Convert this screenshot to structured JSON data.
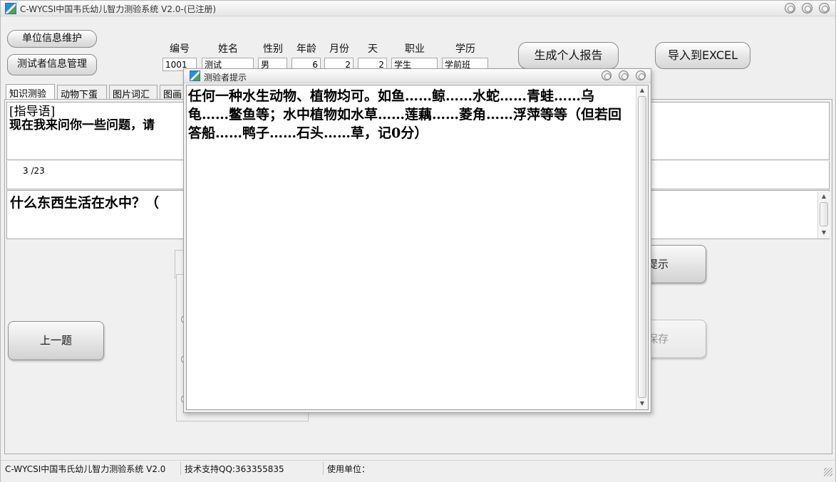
{
  "window": {
    "title": "C-WYCSI中国韦氏幼儿智力测验系统 V2.0-(已注册)"
  },
  "buttons": {
    "unit_info": "单位信息维护",
    "tester_info": "测试者信息管理",
    "generate_report": "生成个人报告",
    "export_excel": "导入到EXCEL",
    "prev_question": "上一题",
    "hint_partial": "提示",
    "save_partial": "保存"
  },
  "subject": {
    "labels": {
      "id": "编号",
      "name": "姓名",
      "gender": "性别",
      "age": "年龄",
      "month": "月份",
      "day": "天",
      "job": "职业",
      "education": "学历"
    },
    "values": {
      "id": "1001",
      "name": "测试",
      "gender": "男",
      "age": "6",
      "month": "2",
      "day": "2",
      "job": "学生",
      "education": "学前班"
    }
  },
  "tabs": [
    "知识测验",
    "动物下蛋",
    "图片词汇",
    "图画"
  ],
  "instruction": {
    "heading": "[指导语]",
    "text_visible": "现在我来问你一些问题，请"
  },
  "progress": "3 /23",
  "question": {
    "text_visible": "什么东西生活在水中？（"
  },
  "dialog": {
    "title": "测验者提示",
    "body": "任何一种水生动物、植物均可。如鱼……鲸……水蛇……青蛙……乌龟……鳖鱼等；水中植物如水草……莲藕……菱角……浮萍等等（但若回答船……鸭子……石头……草，记0分）"
  },
  "statusbar": {
    "app": "C-WYCSI中国韦氏幼儿智力测验系统 V2.0",
    "support": "技术支持QQ:363355835",
    "unit": "使用单位："
  },
  "icons": {
    "app": "app-icon",
    "window_controls": [
      "minimize-icon",
      "maximize-icon",
      "close-icon"
    ]
  }
}
